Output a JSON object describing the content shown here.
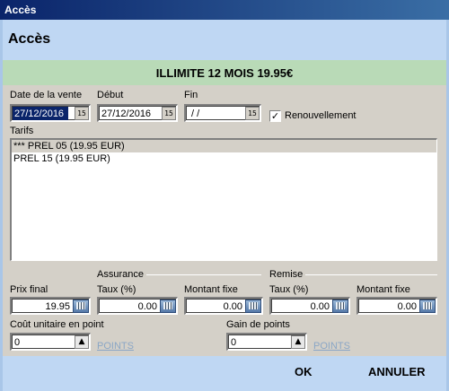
{
  "window": {
    "title": "Accès"
  },
  "header": {
    "title": "Accès"
  },
  "banner": {
    "text": "ILLIMITE 12 MOIS 19.95€"
  },
  "dates": {
    "vente_label": "Date de la vente",
    "vente_value": "27/12/2016",
    "debut_label": "Début",
    "debut_value": "27/12/2016",
    "fin_label": "Fin",
    "fin_value": " / /",
    "cal_glyph": "15"
  },
  "renouvellement": {
    "label": "Renouvellement",
    "checked": true,
    "mark": "✓"
  },
  "tarifs": {
    "label": "Tarifs",
    "items": [
      "*** PREL 05 (19.95 EUR)",
      "PREL 15 (19.95 EUR)"
    ],
    "selected_index": 0
  },
  "prix": {
    "label": "Prix final",
    "value": "19.95"
  },
  "assurance": {
    "group_label": "Assurance",
    "taux_label": "Taux (%)",
    "taux_value": "0.00",
    "montant_label": "Montant fixe",
    "montant_value": "0.00"
  },
  "remise": {
    "group_label": "Remise",
    "taux_label": "Taux (%)",
    "taux_value": "0.00",
    "montant_label": "Montant fixe",
    "montant_value": "0.00"
  },
  "cout": {
    "label": "Coût unitaire en point",
    "value": "0",
    "unit": "POINTS"
  },
  "gain": {
    "label": "Gain de points",
    "value": "0",
    "unit": "POINTS"
  },
  "footer": {
    "ok_label": "OK",
    "cancel_label": "ANNULER"
  }
}
